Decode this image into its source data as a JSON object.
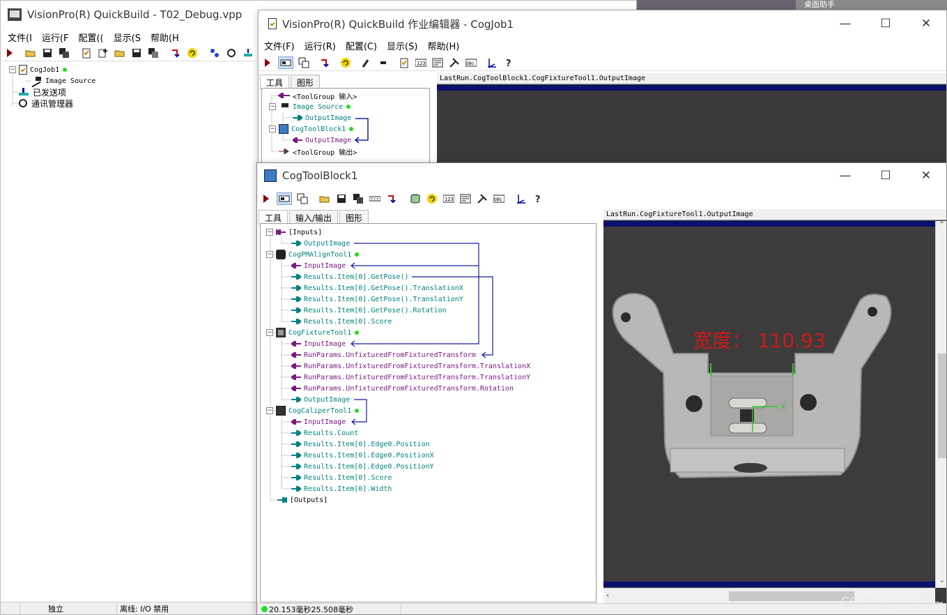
{
  "desktop": {
    "corner_text": "桌面助手"
  },
  "main_window": {
    "title": "VisionPro(R) QuickBuild - T02_Debug.vpp",
    "menu": [
      "文件(I",
      "运行(F",
      "配置((",
      "显示(S",
      "帮助(H"
    ],
    "tree": {
      "job": "CogJob1",
      "image_source": "Image Source",
      "sent_items": "已发送项",
      "comm_manager": "通讯管理器"
    },
    "status": [
      "独立",
      "离线: I/O 禁用"
    ]
  },
  "job_editor": {
    "title": "VisionPro(R) QuickBuild 作业编辑器 - CogJob1",
    "menu": [
      "文件(F)",
      "运行(R)",
      "配置(C)",
      "显示(S)",
      "帮助(H)"
    ],
    "tabs": [
      "工具",
      "图形"
    ],
    "tree": {
      "input": "<ToolGroup 输入>",
      "image_source": "Image Source",
      "output_image_1": "OutputImage",
      "tool_block": "CogToolBlock1",
      "output_image_2": "OutputImage",
      "output": "<ToolGroup 输出>"
    },
    "image_header": "LastRun.CogToolBlock1.CogFixtureTool1.OutputImage"
  },
  "tool_block": {
    "title": "CogToolBlock1",
    "tabs": [
      "工具",
      "输入/输出",
      "图形"
    ],
    "tree": {
      "inputs": "[Inputs]",
      "inputs_output_image": "OutputImage",
      "pmalign": "CogPMAlignTool1",
      "pmalign_input": "InputImage",
      "pmalign_results": [
        "Results.Item[0].GetPose()",
        "Results.Item[0].GetPose().TranslationX",
        "Results.Item[0].GetPose().TranslationY",
        "Results.Item[0].GetPose().Rotation",
        "Results.Item[0].Score"
      ],
      "fixture": "CogFixtureTool1",
      "fixture_input": "InputImage",
      "fixture_params": [
        "RunParams.UnfixturedFromFixturedTransform",
        "RunParams.UnfixturedFromFixturedTransform.TranslationX",
        "RunParams.UnfixturedFromFixturedTransform.TranslationY",
        "RunParams.UnfixturedFromFixturedTransform.Rotation"
      ],
      "fixture_output": "OutputImage",
      "caliper": "CogCaliperTool1",
      "caliper_input": "InputImage",
      "caliper_results": [
        "Results.Count",
        "Results.Item[0].Edge0.Position",
        "Results.Item[0].Edge0.PositionX",
        "Results.Item[0].Edge0.PositionY",
        "Results.Item[0].Score",
        "Results.Item[0].Width"
      ],
      "outputs": "[Outputs]"
    },
    "image_header": "LastRun.CogFixtureTool1.OutputImage",
    "overlay_text": "宽度：  110.93",
    "status": "20.153毫秒25.508毫秒"
  },
  "watermark": "CSDN @~枫钨~",
  "colors": {
    "teal": "#008080",
    "purple": "#7a1a80",
    "link_blue": "#1a1aa8",
    "status_green": "#22dd22",
    "overlay_red": "#d01818",
    "navy": "#0b0f6e"
  }
}
